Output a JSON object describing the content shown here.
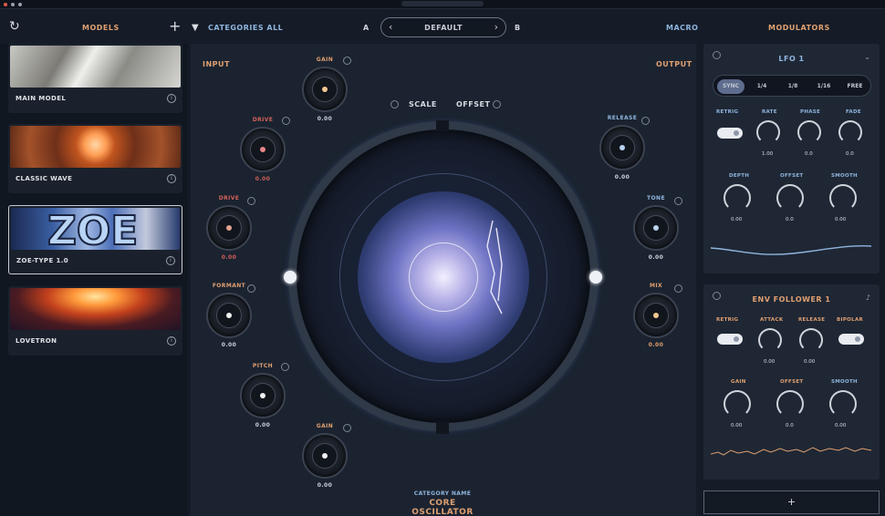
{
  "topbar": {
    "models_label": "MODELS",
    "add_label": "+",
    "collection_label": "CATEGORIES ALL",
    "a_label": "A",
    "b_label": "B",
    "preset_name": "DEFAULT",
    "macro_label": "MACRO",
    "modulators_label": "MODULATORS"
  },
  "models": [
    {
      "name": "MAIN MODEL",
      "selected": false
    },
    {
      "name": "CLASSIC WAVE",
      "selected": false
    },
    {
      "name": "ZOE-TYPE 1.0",
      "selected": true
    },
    {
      "name": "LOVETRON",
      "selected": false
    }
  ],
  "main": {
    "input_label": "INPUT",
    "output_label": "OUTPUT",
    "scale_label": "SCALE",
    "offset_label": "OFFSET",
    "footer_small": "CATEGORY NAME",
    "footer_title": "CORE OSCILLATOR",
    "left_knobs": [
      {
        "top": "GAIN",
        "bottom": "0.00",
        "pip": "#f0c790",
        "top_color": "orange"
      },
      {
        "top": "DRIVE",
        "bottom": "0.00",
        "pip": "#e58686",
        "top_color": "red"
      },
      {
        "top": "DRIVE",
        "bottom": "0.00",
        "pip": "#e1a190",
        "top_color": "red"
      },
      {
        "top": "FORMANT",
        "bottom": "0.00",
        "pip": "#f1f1f1",
        "top_color": "orange"
      },
      {
        "top": "PITCH",
        "bottom": "0.00",
        "pip": "#f1f1f1",
        "top_color": "orange"
      },
      {
        "top": "GAIN",
        "bottom": "0.00",
        "pip": "#f1f1f1",
        "top_color": "orange"
      }
    ],
    "right_knobs": [
      {
        "top": "RELEASE",
        "bottom": "0.00",
        "pip": "#b7d3ef",
        "top_color": "blue"
      },
      {
        "top": "TONE",
        "bottom": "0.00",
        "pip": "#b7d3ef",
        "top_color": "blue"
      },
      {
        "top": "MIX",
        "bottom": "0.00",
        "pip": "#f0c790",
        "top_color": "orange"
      }
    ]
  },
  "lfo_panel": {
    "title": "LFO 1",
    "tabs": [
      "SYNC",
      "1/4",
      "1/8",
      "1/16",
      "FREE"
    ],
    "row1_labels": [
      "RETRIG",
      "RATE",
      "PHASE",
      "FADE"
    ],
    "row1_values": [
      "",
      "1.00",
      "0.0",
      "0.0"
    ],
    "row2_labels": [
      "DEPTH",
      "OFFSET",
      "SMOOTH"
    ],
    "row2_values": [
      "0.00",
      "0.0",
      "0.00"
    ],
    "accent": "#8fb5de"
  },
  "env_panel": {
    "title": "ENV FOLLOWER 1",
    "row1_labels": [
      "RETRIG",
      "ATTACK",
      "RELEASE",
      "BIPOLAR"
    ],
    "row1_values": [
      "",
      "0.00",
      "0.00",
      ""
    ],
    "row2_labels": [
      "GAIN",
      "OFFSET",
      "SMOOTH"
    ],
    "row2_values": [
      "0.00",
      "0.0",
      "0.00"
    ],
    "accent": "#e0a071"
  },
  "add_modulator_label": "+",
  "colors": {
    "bg": "#151c27",
    "panel": "#1f2734",
    "accent_orange": "#e0a071",
    "accent_blue": "#8fb5de"
  }
}
